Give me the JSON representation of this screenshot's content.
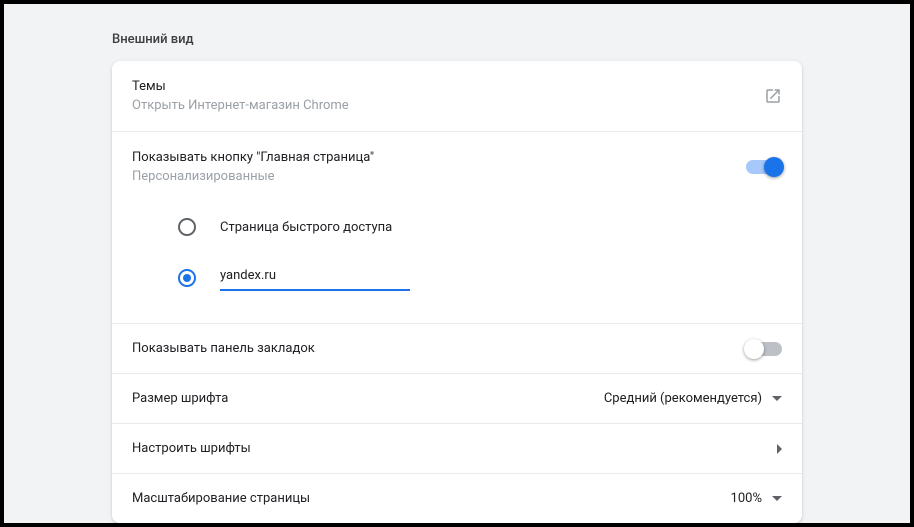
{
  "section_title": "Внешний вид",
  "themes": {
    "title": "Темы",
    "subtitle": "Открыть Интернет-магазин Chrome"
  },
  "home_button": {
    "title": "Показывать кнопку \"Главная страница\"",
    "subtitle": "Персонализированные",
    "enabled": true,
    "options": {
      "quick_access": "Страница быстрого доступа",
      "custom_url": "yandex.ru",
      "selected": "custom_url"
    }
  },
  "bookmarks_bar": {
    "title": "Показывать панель закладок",
    "enabled": false
  },
  "font_size": {
    "title": "Размер шрифта",
    "value": "Средний (рекомендуется)"
  },
  "customize_fonts": {
    "title": "Настроить шрифты"
  },
  "page_zoom": {
    "title": "Масштабирование страницы",
    "value": "100%"
  }
}
